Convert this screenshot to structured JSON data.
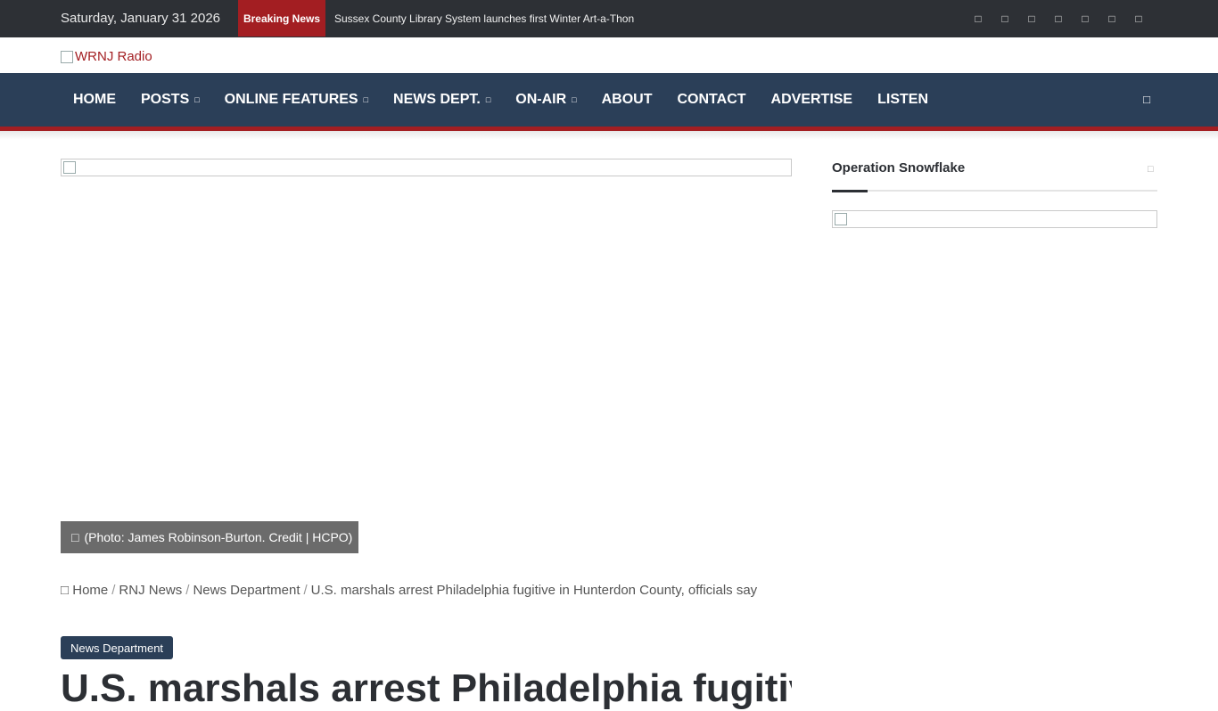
{
  "topbar": {
    "date": "Saturday, January 31 2026",
    "breaking_label": "Breaking News",
    "ticker_text": "Sussex County Library System launches first Winter Art-a-Thon",
    "social_icons": [
      "facebook-icon",
      "twitter-icon",
      "instagram-icon",
      "youtube-icon",
      "tiktok-icon",
      "rss-icon",
      "random-icon"
    ]
  },
  "logo": {
    "alt": "WRNJ Radio"
  },
  "nav": {
    "items": [
      {
        "label": "HOME",
        "has_sub": false
      },
      {
        "label": "POSTS",
        "has_sub": true
      },
      {
        "label": "ONLINE FEATURES",
        "has_sub": true
      },
      {
        "label": "NEWS DEPT.",
        "has_sub": true
      },
      {
        "label": "ON-AIR",
        "has_sub": true
      },
      {
        "label": "ABOUT",
        "has_sub": false
      },
      {
        "label": "CONTACT",
        "has_sub": false
      },
      {
        "label": "ADVERTISE",
        "has_sub": false
      },
      {
        "label": "LISTEN",
        "has_sub": false
      }
    ]
  },
  "article": {
    "caption": "(Photo: James Robinson-Burton. Credit | HCPO)",
    "breadcrumb": [
      "Home",
      "RNJ News",
      "News Department",
      "U.S. marshals arrest Philadelphia fugitive in Hunterdon County, officials say"
    ],
    "category": "News Department",
    "headline": "U.S. marshals arrest Philadelphia fugitive in Hunterdon County, officials say"
  },
  "sidebar": {
    "widget_title": "Operation Snowflake"
  },
  "colors": {
    "accent": "#a31e22",
    "nav_bg": "#2b3f58",
    "topbar_bg": "#2d3035"
  }
}
